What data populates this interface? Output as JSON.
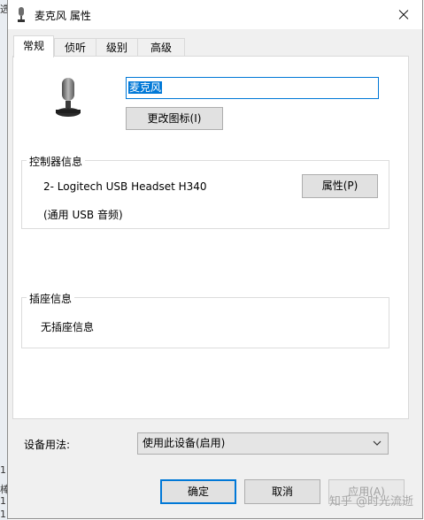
{
  "background": {
    "snippets": [
      "选",
      "1",
      "棒",
      "1",
      "1"
    ]
  },
  "window": {
    "title": "麦克风 属性",
    "icon": "microphone-icon",
    "close_icon": "close-icon"
  },
  "tabs": [
    {
      "label": "常规",
      "selected": true
    },
    {
      "label": "侦听",
      "selected": false
    },
    {
      "label": "级别",
      "selected": false
    },
    {
      "label": "高级",
      "selected": false
    }
  ],
  "general": {
    "device_icon": "microphone-icon",
    "name_value": "麦克风",
    "change_icon_label": "更改图标(I)",
    "controller": {
      "heading": "控制器信息",
      "device": "2- Logitech USB Headset H340",
      "type": "(通用 USB 音频)",
      "properties_label": "属性(P)"
    },
    "jack": {
      "heading": "插座信息",
      "text": "无插座信息"
    },
    "usage": {
      "label": "设备用法:",
      "selected": "使用此设备(启用)",
      "icon": "chevron-down-icon"
    }
  },
  "footer": {
    "ok": "确定",
    "cancel": "取消",
    "apply": "应用(A)"
  },
  "watermark": "知乎 @时光流逝",
  "colors": {
    "accent": "#0078d7",
    "dialog_bg": "#f0f0f0",
    "panel_bg": "#ffffff"
  }
}
